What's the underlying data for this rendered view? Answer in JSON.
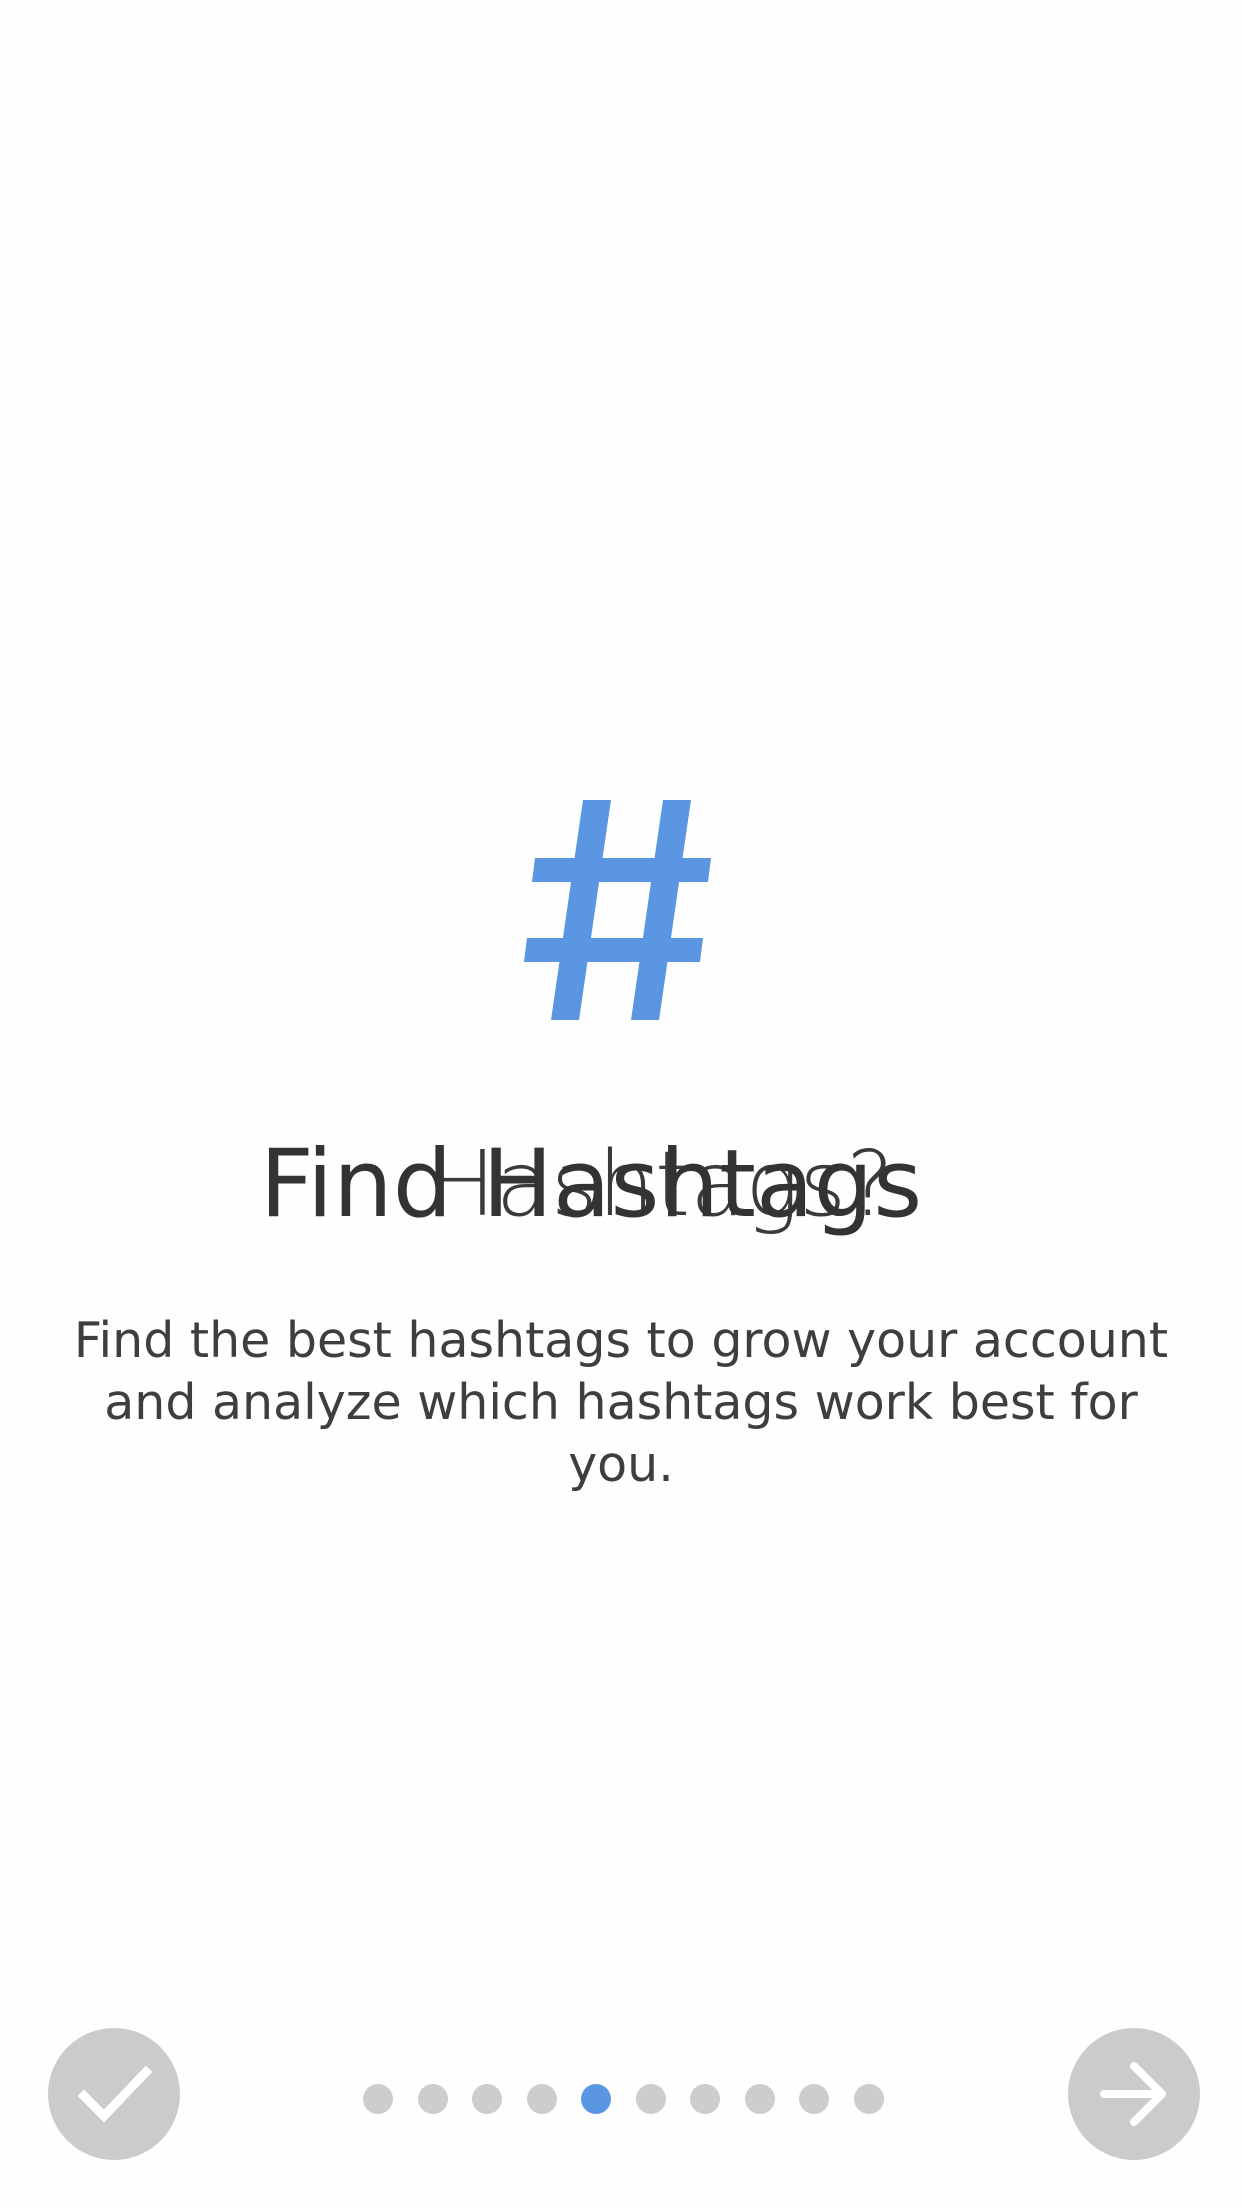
{
  "colors": {
    "accent": "#5a96e2",
    "text": "#333333",
    "button_bg": "#cbcbcb",
    "dot_inactive": "#cdcdcd"
  },
  "hero": {
    "icon": "hashtag-icon"
  },
  "onboarding": {
    "title_primary": "Find Hashtags",
    "title_secondary": "Hashtags?",
    "description_line1": "Find the best hashtags to grow your account",
    "description_line2": "and analyze which hashtags work best for you."
  },
  "pager": {
    "total_pages": 10,
    "current_page": 5
  },
  "controls": {
    "done_icon": "checkmark-icon",
    "next_icon": "arrow-right-icon"
  }
}
